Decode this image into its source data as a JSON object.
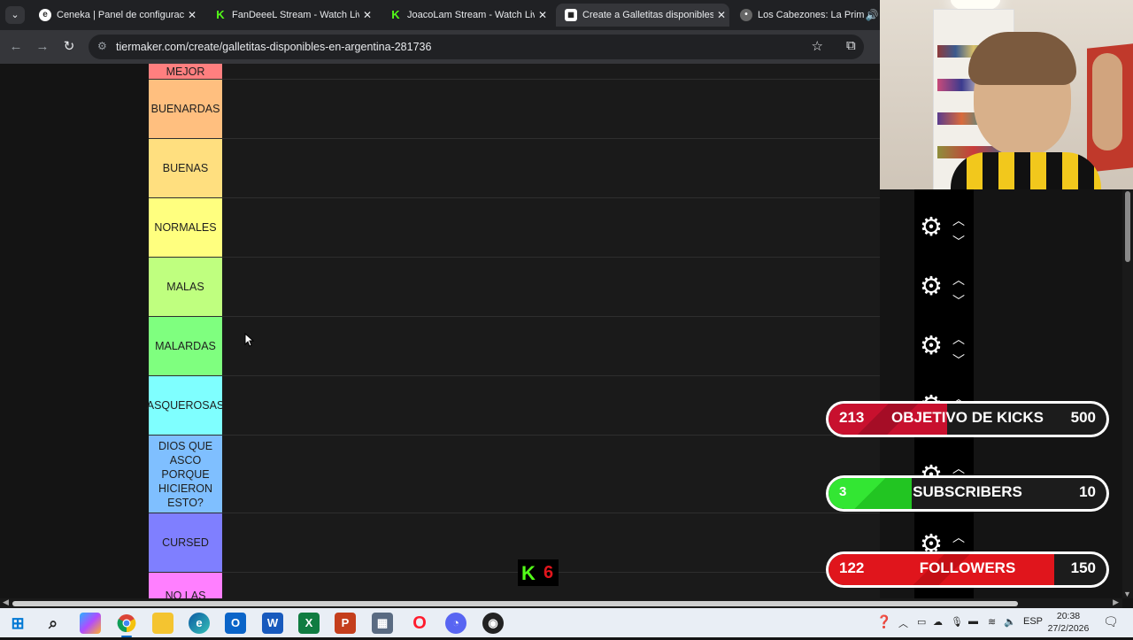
{
  "browser": {
    "tabs": [
      {
        "title": "Ceneka | Panel de configuración",
        "favicon": "edge-e-icon",
        "active": false
      },
      {
        "title": "FanDeeeL Stream - Watch Live on Kick",
        "favicon": "kick-icon",
        "active": false
      },
      {
        "title": "JoacoLam Stream - Watch Live on Kick",
        "favicon": "kick-icon",
        "active": false
      },
      {
        "title": "Create a Galletitas disponibles en Argentina Tier List",
        "favicon": "tiermaker-icon",
        "active": true
      },
      {
        "title": "Los Cabezones: La Primera",
        "favicon": "generic-site-icon",
        "active": false
      }
    ],
    "close_glyph": "✕",
    "url": "tiermaker.com/create/galletitas-disponibles-en-argentina-281736"
  },
  "tierlist": {
    "rows": [
      {
        "label": "MEJOR",
        "color": "#ff7f7f"
      },
      {
        "label": "BUENARDAS",
        "color": "#ffbf7f"
      },
      {
        "label": "BUENAS",
        "color": "#ffdf7f"
      },
      {
        "label": "NORMALES",
        "color": "#ffff7f"
      },
      {
        "label": "MALAS",
        "color": "#bfff7f"
      },
      {
        "label": "MALARDAS",
        "color": "#7fff7f"
      },
      {
        "label": "ASQUEROSAS",
        "color": "#7fffff"
      },
      {
        "label": "DIOS QUE ASCO PORQUE HICIERON ESTO?",
        "color": "#7fbfff"
      },
      {
        "label": "CURSED",
        "color": "#7f7fff"
      },
      {
        "label": "NO LAS",
        "color": "#ff7fff"
      }
    ]
  },
  "overlays": {
    "kicks_goal": {
      "current": "213",
      "label": "OBJETIVO DE KICKS",
      "goal": "500",
      "progress": 0.426,
      "color": "#c8102e"
    },
    "subscribers_goal": {
      "current": "3",
      "label": "SUBSCRIBERS",
      "goal": "10",
      "progress": 0.3,
      "color": "#33e633"
    },
    "followers_goal": {
      "current": "122",
      "label": "FOLLOWERS",
      "goal": "150",
      "progress": 0.813,
      "color": "#e0151c"
    },
    "kick_badge": {
      "letter": "K",
      "count": "6"
    }
  },
  "taskbar": {
    "apps": [
      "windows-start-icon",
      "search-icon",
      "copilot-icon",
      "chrome-icon",
      "file-explorer-icon",
      "edge-icon",
      "outlook-icon",
      "word-icon",
      "excel-icon",
      "powerpoint-icon",
      "calculator-icon",
      "opera-icon",
      "discord-icon",
      "obs-icon"
    ],
    "language": "ESP",
    "time": "20:38",
    "date": "27/2/2026"
  }
}
